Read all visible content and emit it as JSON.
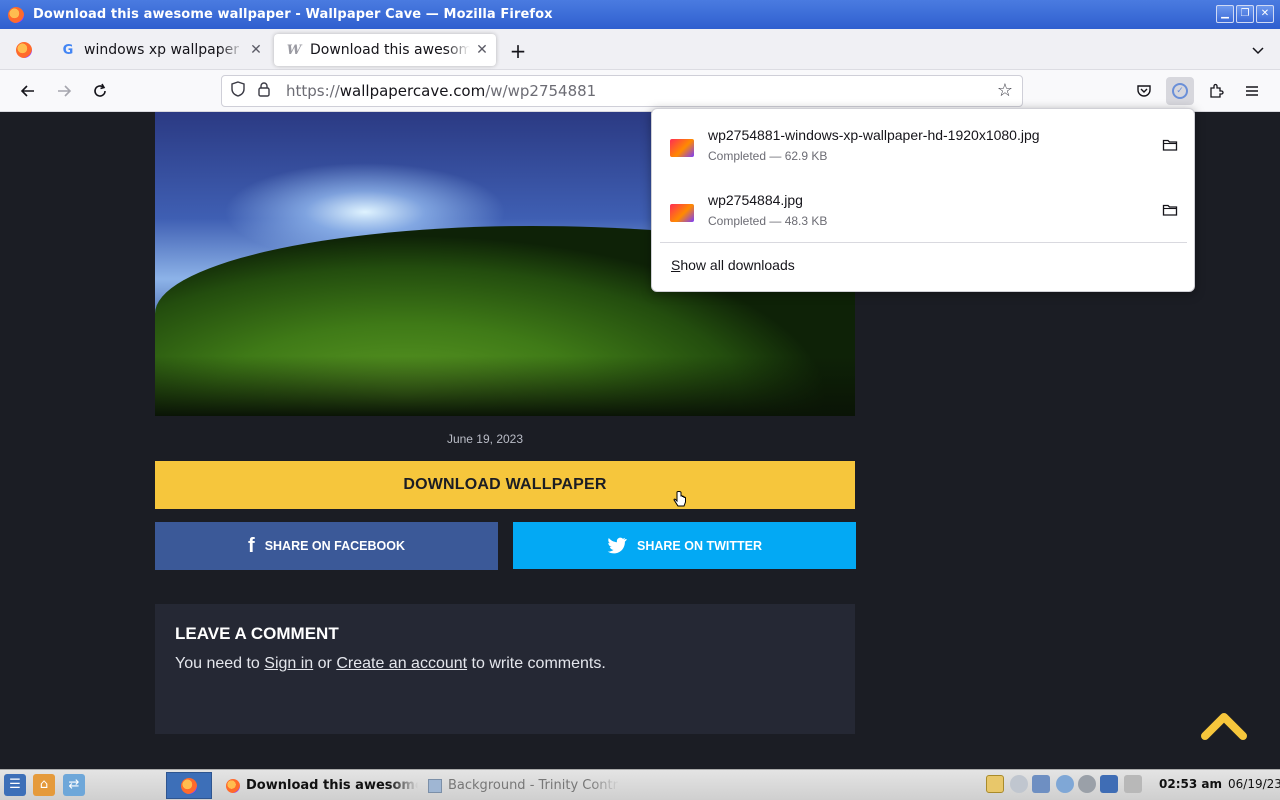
{
  "window": {
    "title": "Download this awesome wallpaper - Wallpaper Cave — Mozilla Firefox",
    "buttons": [
      "minimize",
      "restore",
      "close"
    ]
  },
  "tabs": [
    {
      "label": "windows xp wallpaper hig",
      "favicon": "google-icon",
      "active": false
    },
    {
      "label": "Download this awesome w",
      "favicon": "wallpapercave-icon",
      "active": true
    }
  ],
  "navbar": {
    "url_scheme": "https://",
    "url_host": "wallpapercave.com",
    "url_path": "/w/wp2754881"
  },
  "downloads": {
    "items": [
      {
        "filename": "wp2754881-windows-xp-wallpaper-hd-1920x1080.jpg",
        "status": "Completed — 62.9 KB"
      },
      {
        "filename": "wp2754884.jpg",
        "status": "Completed — 48.3 KB"
      }
    ],
    "show_all_first": "S",
    "show_all_rest": "how all downloads"
  },
  "page": {
    "date": "June 19, 2023",
    "download_label": "DOWNLOAD WALLPAPER",
    "share_facebook": "SHARE ON FACEBOOK",
    "share_twitter": "SHARE ON TWITTER",
    "comment_heading": "LEAVE A COMMENT",
    "comment_prefix": "You need to ",
    "sign_in": "Sign in",
    "comment_or": " or ",
    "create_account": "Create an account",
    "comment_suffix": " to write comments."
  },
  "taskbar": {
    "task1": "Download this awesome",
    "task2": "Background - Trinity Contr",
    "time": "02:53 am",
    "date": "06/19/23"
  },
  "colors": {
    "accent_yellow": "#f6c63c",
    "facebook": "#3b5998",
    "twitter": "#03a9f4",
    "page_bg": "#1b1d24"
  }
}
